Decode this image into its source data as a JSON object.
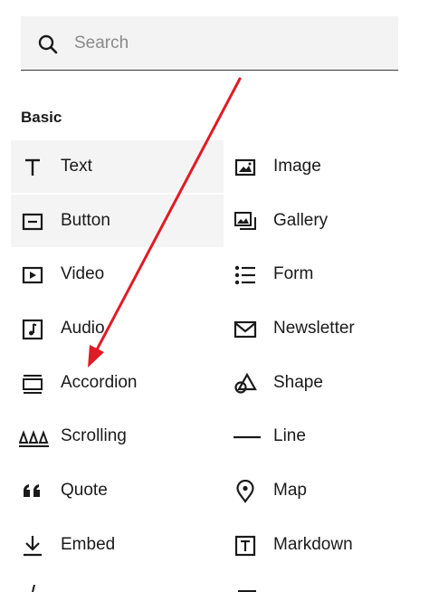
{
  "search": {
    "placeholder": "Search",
    "value": ""
  },
  "section": {
    "title": "Basic"
  },
  "blocks": {
    "left": [
      {
        "label": "Text",
        "icon": "text-icon"
      },
      {
        "label": "Button",
        "icon": "button-icon"
      },
      {
        "label": "Video",
        "icon": "video-icon"
      },
      {
        "label": "Audio",
        "icon": "audio-icon"
      },
      {
        "label": "Accordion",
        "icon": "accordion-icon"
      },
      {
        "label": "Scrolling",
        "icon": "scrolling-icon"
      },
      {
        "label": "Quote",
        "icon": "quote-icon"
      },
      {
        "label": "Embed",
        "icon": "embed-icon"
      }
    ],
    "right": [
      {
        "label": "Image",
        "icon": "image-icon"
      },
      {
        "label": "Gallery",
        "icon": "gallery-icon"
      },
      {
        "label": "Form",
        "icon": "form-icon"
      },
      {
        "label": "Newsletter",
        "icon": "newsletter-icon"
      },
      {
        "label": "Shape",
        "icon": "shape-icon"
      },
      {
        "label": "Line",
        "icon": "line-icon"
      },
      {
        "label": "Map",
        "icon": "map-pin-icon"
      },
      {
        "label": "Markdown",
        "icon": "markdown-icon"
      }
    ]
  },
  "annotation": {
    "arrow_color": "#e01b24"
  }
}
